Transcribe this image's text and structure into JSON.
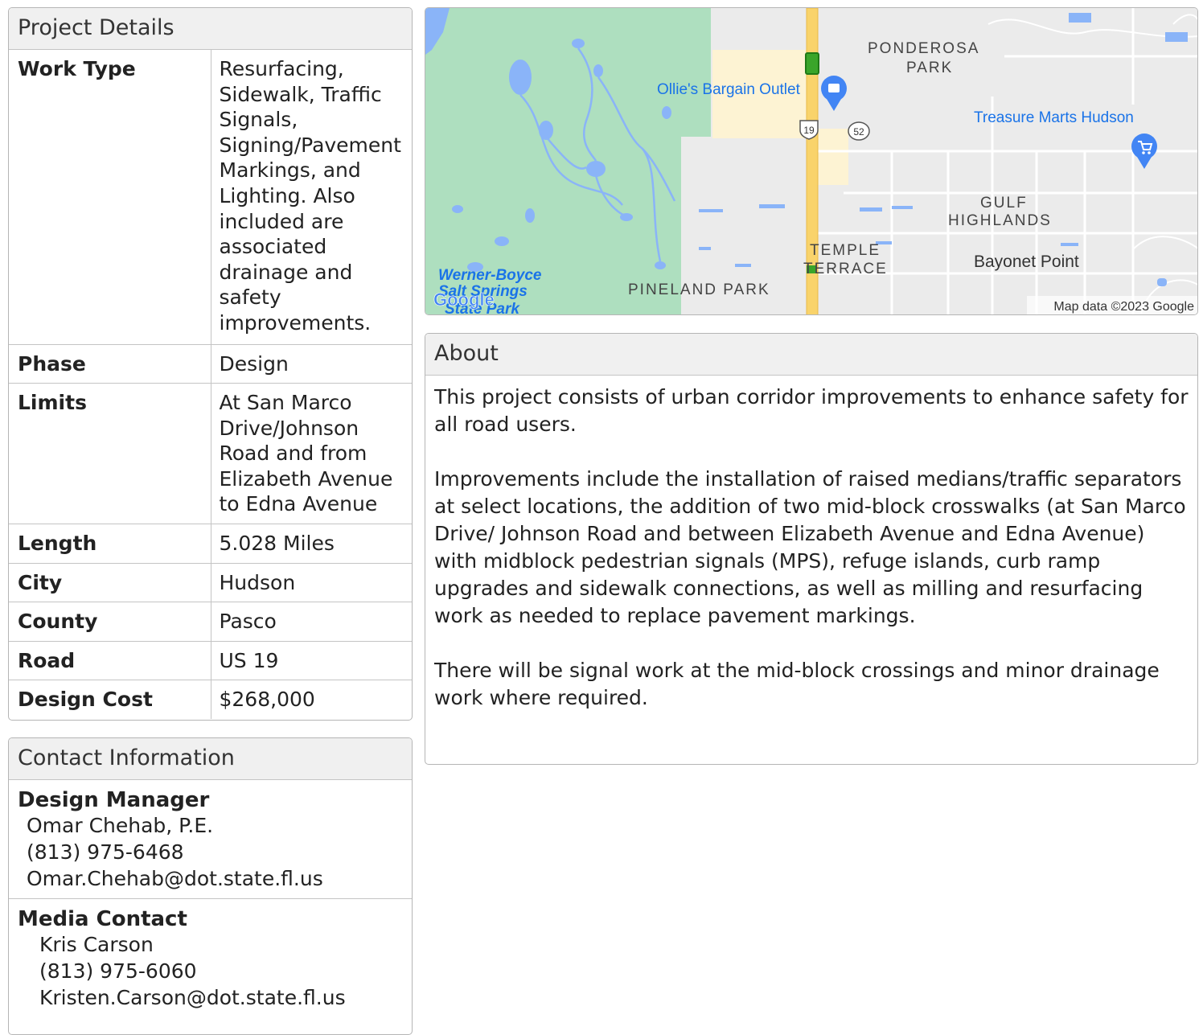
{
  "project_details": {
    "title": "Project Details",
    "rows": [
      {
        "label": "Work Type",
        "value": "Resurfacing, Sidewalk, Traffic Signals, Signing/Pavement Markings, and Lighting. Also included are associated drainage and safety improvements."
      },
      {
        "label": "Phase",
        "value": "Design"
      },
      {
        "label": "Limits",
        "value": "At San Marco Drive/Johnson Road and from Elizabeth Avenue to Edna Avenue"
      },
      {
        "label": "Length",
        "value": "5.028 Miles"
      },
      {
        "label": "City",
        "value": "Hudson"
      },
      {
        "label": "County",
        "value": "Pasco"
      },
      {
        "label": "Road",
        "value": "US 19"
      },
      {
        "label": "Design Cost",
        "value": "$268,000"
      }
    ]
  },
  "contact": {
    "title": "Contact Information",
    "design_manager": {
      "role": "Design Manager",
      "name": "Omar Chehab, P.E.",
      "phone": "(813) 975-6468",
      "email": "Omar.Chehab@dot.state.fl.us"
    },
    "media_contact": {
      "role": "Media Contact",
      "name": "Kris Carson",
      "phone": "(813) 975-6060",
      "email": "Kristen.Carson@dot.state.fl.us"
    }
  },
  "map": {
    "labels": {
      "ponderosa_1": "PONDEROSA",
      "ponderosa_2": "PARK",
      "ollies": "Ollie's Bargain Outlet",
      "treasure": "Treasure Marts Hudson",
      "gulf_1": "GULF",
      "gulf_2": "HIGHLANDS",
      "temple_1": "TEMPLE",
      "temple_2": "TERRACE",
      "bayonet": "Bayonet Point",
      "pineland": "PINELAND PARK",
      "werner_1": "Werner-Boyce",
      "werner_2": "Salt Springs",
      "werner_3": "State Park",
      "shield_19": "19",
      "shield_52": "52",
      "attribution": "Map data ©2023 Google",
      "google_logo": "Google"
    },
    "colors": {
      "park": "#aedfbf",
      "water": "#8ab4f8",
      "highway": "#f9d36b",
      "poi_pin": "#4285f4",
      "project_marker": "#3aa52a"
    }
  },
  "about": {
    "title": "About",
    "paragraphs": [
      "This project consists of urban corridor improvements to enhance safety for all road users.",
      "Improvements include the installation of raised medians/traffic separators at select locations, the addition of two mid-block crosswalks (at San Marco Drive/ Johnson Road and between Elizabeth Avenue and Edna Avenue) with midblock pedestrian signals (MPS), refuge islands, curb ramp upgrades and sidewalk connections, as well as milling and resurfacing work as needed to replace pavement markings.",
      "There will be signal work at the mid-block crossings and minor drainage work where required."
    ]
  }
}
